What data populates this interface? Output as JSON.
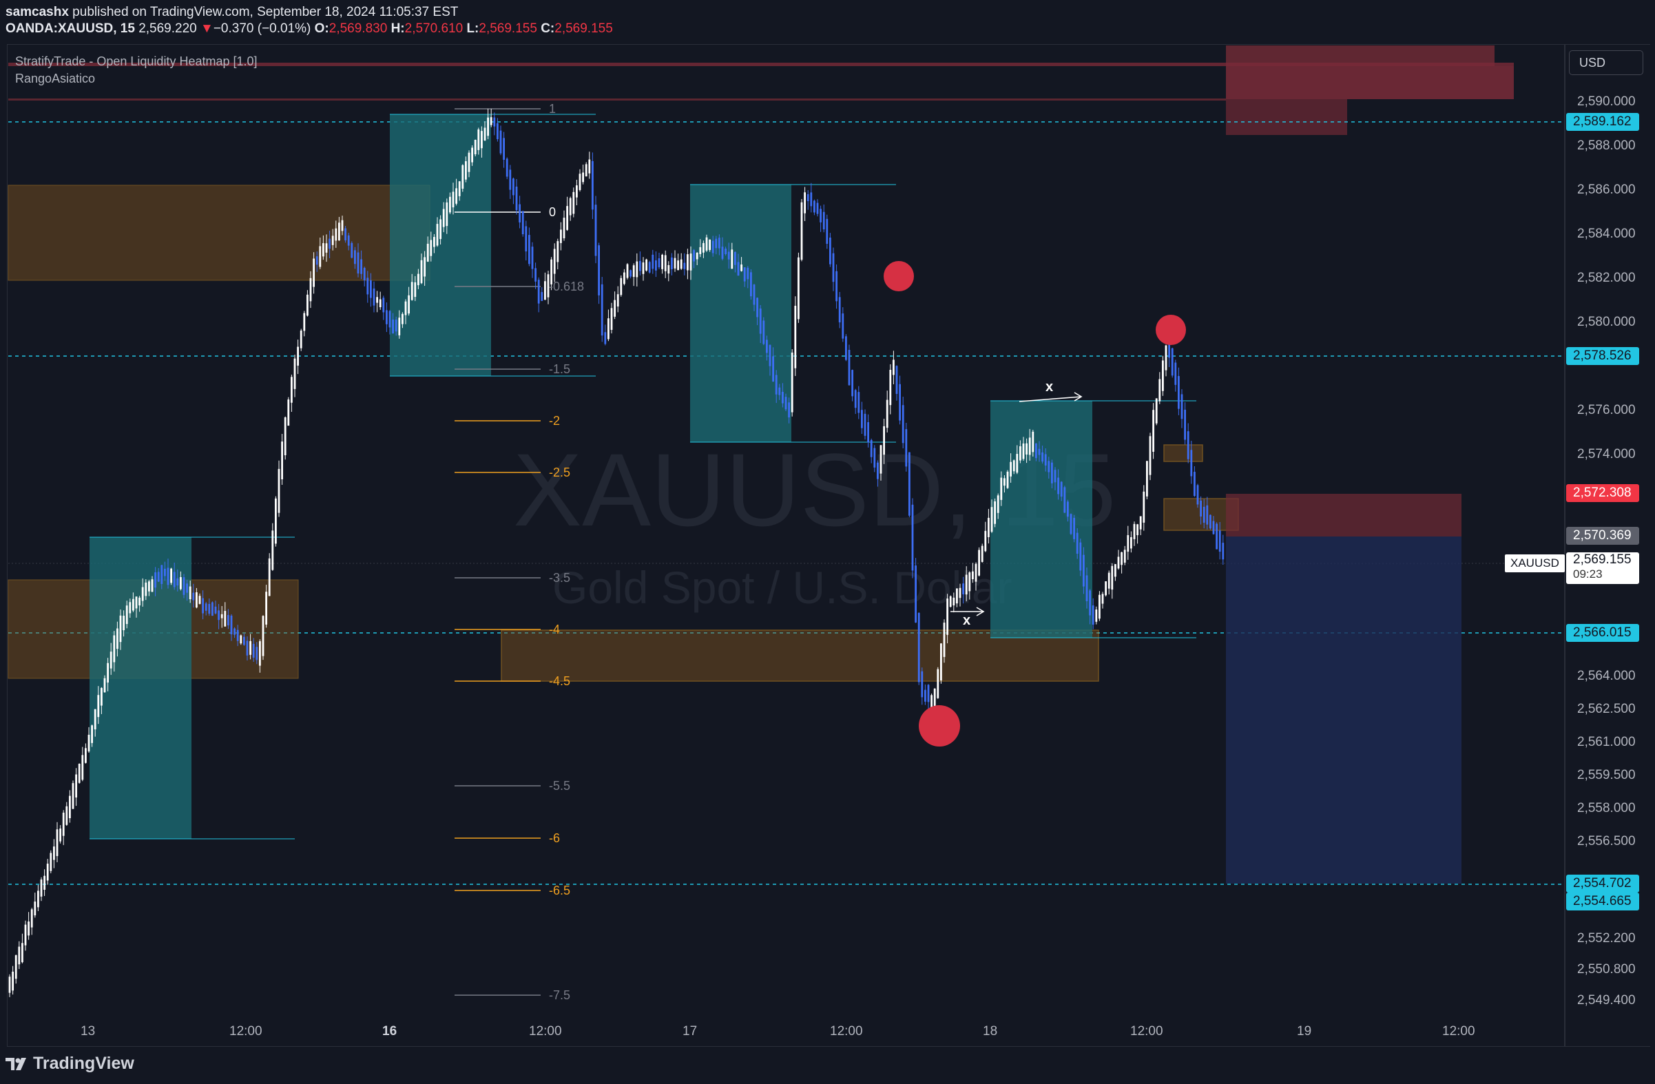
{
  "header": {
    "publisher_user": "samcashx",
    "publisher_text": " published on TradingView.com, September 18, 2024 11:05:37 EST",
    "symbol": "OANDA:XAUUSD, 15",
    "last": "2,569.220",
    "change": "−0.370 (−0.01%)",
    "o_label": "O:",
    "o": "2,569.830",
    "h_label": "H:",
    "h": "2,570.610",
    "l_label": "L:",
    "l": "2,569.155",
    "c_label": "C:",
    "c": "2,569.155"
  },
  "indicators": [
    "StratifyTrade - Open Liquidity Heatmap [1.0]",
    "RangoAsiatico"
  ],
  "watermark": {
    "symbol": "XAUUSD, 15",
    "description": "Gold Spot / U.S. Dollar"
  },
  "currency": "USD",
  "price_axis": {
    "labels": [
      "2,590.000",
      "2,588.000",
      "2,586.000",
      "2,584.000",
      "2,582.000",
      "2,580.000",
      "2,576.000",
      "2,574.000",
      "2,564.000",
      "2,562.500",
      "2,561.000",
      "2,559.500",
      "2,558.000",
      "2,556.500",
      "2,552.200",
      "2,550.800",
      "2,549.400"
    ],
    "badges": [
      {
        "value": "2,589.162",
        "style": "cyan"
      },
      {
        "value": "2,578.526",
        "style": "cyan"
      },
      {
        "value": "2,572.308",
        "style": "red"
      },
      {
        "value": "2,570.369",
        "style": "gray"
      },
      {
        "value": "2,566.015",
        "style": "cyan"
      },
      {
        "value": "2,554.702",
        "style": "cyan"
      },
      {
        "value": "2,554.665",
        "style": "cyan"
      }
    ],
    "current": {
      "symbol": "XAUUSD",
      "price": "2,569.155",
      "countdown": "09:23"
    }
  },
  "time_axis": [
    "13",
    "12:00",
    "16",
    "12:00",
    "17",
    "12:00",
    "18",
    "12:00",
    "19",
    "12:00"
  ],
  "fib_levels": [
    {
      "label": "1",
      "color": "gray"
    },
    {
      "label": "0",
      "color": "white"
    },
    {
      "label": "-0.618",
      "color": "gray"
    },
    {
      "label": "-1.5",
      "color": "gray"
    },
    {
      "label": "-2",
      "color": "orange"
    },
    {
      "label": "-2.5",
      "color": "orange"
    },
    {
      "label": "-3.5",
      "color": "gray"
    },
    {
      "label": "-4",
      "color": "orange"
    },
    {
      "label": "-4.5",
      "color": "orange"
    },
    {
      "label": "-5.5",
      "color": "gray"
    },
    {
      "label": "-6",
      "color": "orange"
    },
    {
      "label": "-6.5",
      "color": "orange"
    },
    {
      "label": "-7.5",
      "color": "gray"
    }
  ],
  "marks": {
    "x1": "x",
    "x2": "x"
  },
  "footer": {
    "brand": "TradingView"
  },
  "colors": {
    "background": "#131722",
    "bull": "#ffffff",
    "bear": "#3d6ef5",
    "accent_cyan": "#22c5e3",
    "red": "#f23645",
    "orange": "#f0a020"
  }
}
